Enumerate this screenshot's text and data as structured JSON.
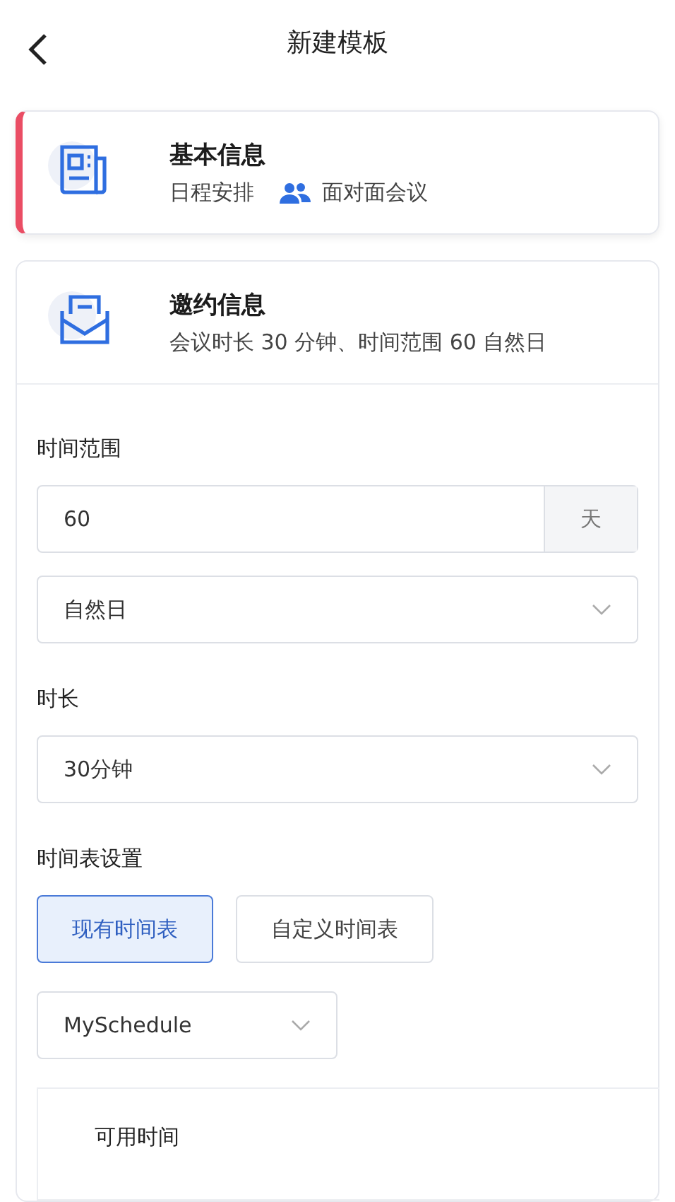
{
  "header": {
    "title": "新建模板"
  },
  "sections": [
    {
      "kind": "basic",
      "title": "基本信息",
      "selected": true,
      "subtitle": "日程安排",
      "meeting_type": "面对面会议"
    },
    {
      "kind": "invite",
      "title": "邀约信息",
      "selected": false,
      "subtitle": "会议时长 30 分钟、时间范围 60 自然日"
    }
  ],
  "form": {
    "range": {
      "label": "时间范围",
      "value": "60",
      "unit": "天",
      "day_type": "自然日"
    },
    "duration": {
      "label": "时长",
      "value": "30分钟"
    },
    "schedule": {
      "label": "时间表设置",
      "options": [
        {
          "label": "现有时间表",
          "selected": true
        },
        {
          "label": "自定义时间表",
          "selected": false
        }
      ],
      "value": "MySchedule"
    },
    "availability": {
      "title": "可用时间"
    }
  }
}
